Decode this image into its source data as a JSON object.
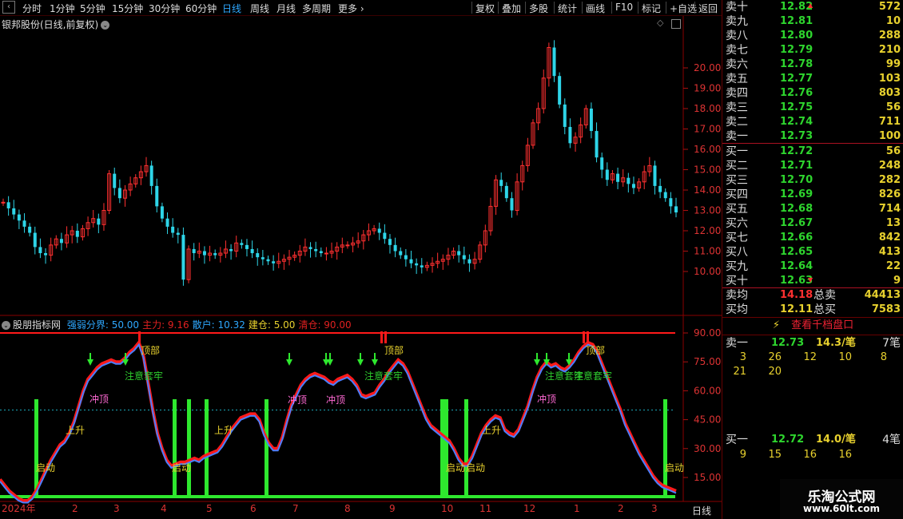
{
  "toolbar": {
    "timeframes": [
      "分时",
      "1分钟",
      "5分钟",
      "15分钟",
      "30分钟",
      "60分钟",
      "日线",
      "周线",
      "月线",
      "多周期",
      "更多"
    ],
    "active": "日线",
    "buttons": [
      "复权",
      "叠加",
      "多股",
      "统计",
      "画线",
      "F10",
      "标记",
      "+自选",
      "返回"
    ]
  },
  "chart": {
    "title": "银邦股份(日线,前复权)",
    "price_ticks": [
      "20.00",
      "19.00",
      "18.00",
      "17.00",
      "16.00",
      "15.00",
      "14.00",
      "13.00",
      "12.00",
      "11.00",
      "10.00"
    ],
    "candles": [
      13.4,
      13.1,
      12.8,
      12.5,
      12.2,
      11.9,
      11.2,
      10.9,
      10.8,
      11.3,
      11.6,
      11.4,
      11.8,
      12.0,
      11.7,
      12.1,
      12.4,
      12.6,
      12.3,
      13.0,
      14.8,
      14.1,
      13.6,
      14.0,
      14.3,
      14.6,
      14.9,
      15.2,
      14.2,
      13.2,
      12.6,
      12.2,
      11.9,
      11.8,
      9.6,
      11.1,
      10.9,
      11.0,
      10.8,
      10.9,
      10.8,
      10.9,
      11.1,
      11.0,
      11.4,
      11.3,
      11.1,
      10.9,
      10.7,
      10.6,
      10.5,
      10.4,
      10.5,
      10.6,
      10.7,
      10.8,
      11.0,
      11.2,
      11.1,
      11.0,
      10.9,
      10.9,
      11.0,
      11.2,
      11.3,
      11.3,
      11.4,
      11.5,
      11.8,
      12.0,
      12.1,
      11.9,
      11.6,
      11.3,
      11.0,
      10.8,
      10.6,
      10.4,
      10.3,
      10.2,
      10.3,
      10.4,
      10.5,
      10.6,
      10.8,
      11.0,
      10.8,
      10.6,
      10.4,
      10.6,
      11.3,
      12.0,
      13.2,
      14.5,
      14.2,
      13.6,
      13.0,
      14.4,
      15.2,
      16.2,
      17.3,
      18.0,
      19.5,
      21.0,
      19.6,
      18.2,
      17.1,
      16.3,
      16.6,
      17.2,
      18.0,
      16.9,
      15.6,
      15.0,
      14.5,
      14.8,
      14.4,
      14.6,
      14.3,
      14.1,
      14.4,
      14.9,
      15.2,
      14.2,
      13.9,
      13.6,
      13.2,
      12.9
    ],
    "x_labels": [
      "2024年",
      "2",
      "3",
      "4",
      "5",
      "6",
      "7",
      "8",
      "9",
      "10",
      "11",
      "12",
      "1",
      "2",
      "3"
    ],
    "period_label": "日线"
  },
  "indicator": {
    "name": "股朋指标网",
    "params": [
      {
        "label": "强弱分界: 50.00",
        "color": "#2ea8ff"
      },
      {
        "label": "主力: 9.16",
        "color": "#e02020"
      },
      {
        "label": "散户: 10.32",
        "color": "#2ea8ff"
      },
      {
        "label": "建仓: 5.00",
        "color": "#e8d12e"
      },
      {
        "label": "清仓: 90.00",
        "color": "#e02020"
      }
    ],
    "ticks": [
      "90.00",
      "75.00",
      "60.00",
      "45.00",
      "30.00",
      "15.00"
    ],
    "line": [
      14,
      11,
      8,
      6,
      4,
      3,
      3,
      5,
      9,
      14,
      19,
      24,
      28,
      32,
      34,
      38,
      44,
      52,
      60,
      66,
      69,
      72,
      74,
      75,
      76,
      75,
      75,
      77,
      80,
      82,
      85,
      78,
      64,
      50,
      38,
      30,
      24,
      21,
      22,
      23,
      23,
      24,
      25,
      24,
      26,
      27,
      28,
      29,
      32,
      36,
      40,
      43,
      46,
      47,
      48,
      48,
      45,
      38,
      33,
      30,
      30,
      36,
      45,
      53,
      58,
      63,
      66,
      68,
      69,
      68,
      67,
      65,
      64,
      66,
      67,
      68,
      66,
      63,
      58,
      57,
      58,
      59,
      63,
      66,
      70,
      73,
      76,
      74,
      70,
      64,
      58,
      52,
      46,
      42,
      40,
      38,
      36,
      34,
      30,
      25,
      22,
      22,
      26,
      32,
      38,
      42,
      45,
      47,
      46,
      40,
      38,
      37,
      40,
      46,
      52,
      60,
      67,
      72,
      75,
      73,
      74,
      72,
      71,
      73,
      76,
      80,
      83,
      85,
      84,
      80,
      74,
      68,
      62,
      56,
      50,
      43,
      38,
      33,
      28,
      24,
      20,
      16,
      13,
      11,
      10,
      9,
      8
    ],
    "pulses": [
      45,
      218,
      236,
      258,
      333,
      553,
      558,
      583,
      832
    ],
    "labels": [
      "启动",
      "上升",
      "冲顶",
      "注意套牢",
      "顶部",
      "启动",
      "上升",
      "冲顶",
      "冲顶",
      "注意套牢",
      "顶部",
      "启动",
      "启动",
      "上升",
      "冲顶",
      "注意套牢",
      "注意套牢",
      "顶部",
      "启动"
    ]
  },
  "orderbook": {
    "asks": [
      {
        "label": "卖十",
        "price": "12.82",
        "vol": "572"
      },
      {
        "label": "卖九",
        "price": "12.81",
        "vol": "10"
      },
      {
        "label": "卖八",
        "price": "12.80",
        "vol": "288"
      },
      {
        "label": "卖七",
        "price": "12.79",
        "vol": "210"
      },
      {
        "label": "卖六",
        "price": "12.78",
        "vol": "99"
      },
      {
        "label": "卖五",
        "price": "12.77",
        "vol": "103"
      },
      {
        "label": "卖四",
        "price": "12.76",
        "vol": "803"
      },
      {
        "label": "卖三",
        "price": "12.75",
        "vol": "56"
      },
      {
        "label": "卖二",
        "price": "12.74",
        "vol": "711"
      },
      {
        "label": "卖一",
        "price": "12.73",
        "vol": "100"
      }
    ],
    "bids": [
      {
        "label": "买一",
        "price": "12.72",
        "vol": "56"
      },
      {
        "label": "买二",
        "price": "12.71",
        "vol": "248"
      },
      {
        "label": "买三",
        "price": "12.70",
        "vol": "282"
      },
      {
        "label": "买四",
        "price": "12.69",
        "vol": "826"
      },
      {
        "label": "买五",
        "price": "12.68",
        "vol": "714"
      },
      {
        "label": "买六",
        "price": "12.67",
        "vol": "13"
      },
      {
        "label": "买七",
        "price": "12.66",
        "vol": "842"
      },
      {
        "label": "买八",
        "price": "12.65",
        "vol": "413"
      },
      {
        "label": "买九",
        "price": "12.64",
        "vol": "22"
      },
      {
        "label": "买十",
        "price": "12.63",
        "vol": "9"
      }
    ],
    "avg_sell": {
      "label": "卖均",
      "price": "14.18",
      "total_label": "总卖",
      "total": "44413"
    },
    "avg_buy": {
      "label": "买均",
      "price": "12.11",
      "total_label": "总买",
      "total": "7583"
    },
    "depth_button": "查看千档盘口",
    "sell1_queue": {
      "label": "卖一",
      "price": "12.73",
      "avg": "14.3/笔",
      "count": "7笔",
      "orders": [
        "3",
        "26",
        "12",
        "10",
        "8",
        "21",
        "20"
      ]
    },
    "buy1_queue": {
      "label": "买一",
      "price": "12.72",
      "avg": "14.0/笔",
      "count": "4笔",
      "orders": [
        "9",
        "15",
        "16",
        "16"
      ]
    }
  },
  "watermark": {
    "title": "乐淘公式网",
    "url": "www.60lt.com"
  },
  "colors": {
    "up": "#ff3030",
    "down": "#2ed5e8",
    "main_line": "#ff1a1a",
    "retail_line": "#4a7fff",
    "pulse": "#2ee82e",
    "threshold": "#1aa6b7"
  }
}
